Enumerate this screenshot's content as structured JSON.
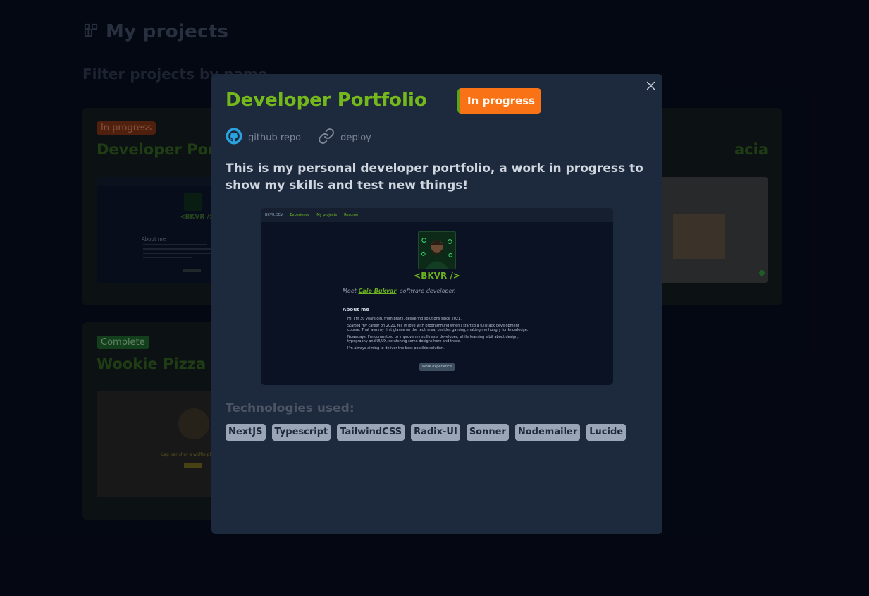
{
  "page": {
    "title": "My projects",
    "filter_label": "Filter projects by name"
  },
  "projects": [
    {
      "status": "In progress",
      "title": "Developer Portfolio"
    },
    {
      "status": "Complete",
      "title": "Wookie Pizza"
    },
    {
      "title_fragment": "acia"
    }
  ],
  "thumbnails": {
    "portfolio_handle": "<BKVR />",
    "portfolio_about": "About me",
    "pizza_tagline": "Lap bar shot a wolfie plu ni..."
  },
  "modal": {
    "title": "Developer Portfolio",
    "status": "In progress",
    "links": {
      "repo": "github repo",
      "deploy": "deploy"
    },
    "description": "This is my personal developer portfolio, a work in progress to show my skills and test new things!",
    "preview": {
      "nav": [
        "BKVR.DEV",
        "Experience",
        "My projects",
        "Resumé"
      ],
      "handle": "<BKVR />",
      "meet_prefix": "Meet ",
      "meet_name": "Caio Bukvar",
      "meet_suffix": ", software developer.",
      "about_title": "About me",
      "about_lines": [
        "Hi! I'm 30 years old, from Brazil, delivering solutions since 2021.",
        "Started my career on 2021, fell in love with programming when I started a fullstack development course. That was my first glance on the tech area, besides gaming, making me hungry for knowledge.",
        "Nowadays, I'm committed to improve my skills as a developer, while learning a bit about design, typography and UI/UX, scratching some designs here and there.",
        "I'm always aiming to deliver the best possible solution."
      ],
      "button": "Work experience"
    },
    "tech_heading": "Technologies used:",
    "technologies": [
      "NextJS",
      "Typescript",
      "TailwindCSS",
      "Radix-UI",
      "Sonner",
      "Nodemailer",
      "Lucide"
    ]
  },
  "colors": {
    "accent_green": "#74b81c",
    "status_orange": "#f97316",
    "modal_bg": "#1d293c",
    "page_bg": "#060a16"
  },
  "icons": [
    "projects-icon",
    "close-icon",
    "github-icon",
    "link-icon"
  ]
}
